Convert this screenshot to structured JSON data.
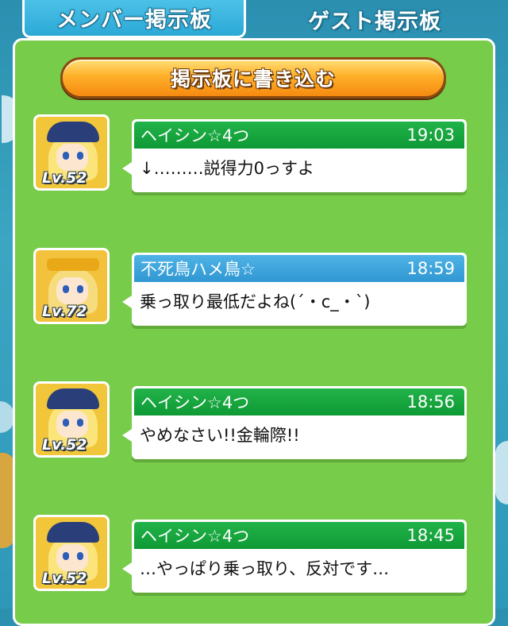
{
  "tabs": {
    "member": "メンバー掲示板",
    "guest": "ゲスト掲示板"
  },
  "write_button": "掲示板に書き込む",
  "colors": {
    "panel": "#77cc4a",
    "header_green": "#0e9934",
    "header_blue": "#2f97d2",
    "tab_active": "#2ba9d6",
    "button_orange": "#f58a10"
  },
  "posts": [
    {
      "avatar_icon": "witch-character-icon",
      "level": "Lv.52",
      "author": "ヘイシン☆4つ",
      "time": "19:03",
      "message": "↓………説得力0っすよ",
      "header_color": "green"
    },
    {
      "avatar_icon": "princess-character-icon",
      "level": "Lv.72",
      "author": "不死鳥ハメ鳥☆",
      "time": "18:59",
      "message": "乗っ取り最低だよね(´・c_・`)",
      "header_color": "blue"
    },
    {
      "avatar_icon": "witch-character-icon",
      "level": "Lv.52",
      "author": "ヘイシン☆4つ",
      "time": "18:56",
      "message": "やめなさい!!金輪際!!",
      "header_color": "green"
    },
    {
      "avatar_icon": "witch-character-icon",
      "level": "Lv.52",
      "author": "ヘイシン☆4つ",
      "time": "18:45",
      "message": "…やっぱり乗っ取り、反対です…",
      "header_color": "green"
    }
  ]
}
